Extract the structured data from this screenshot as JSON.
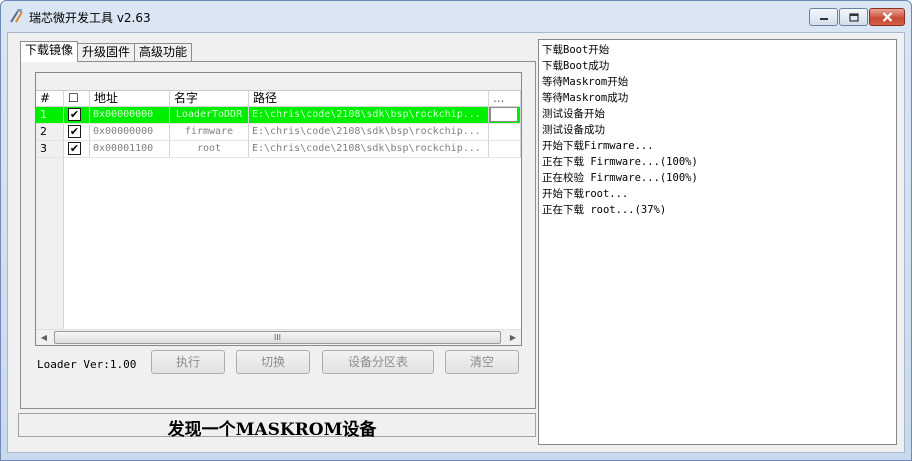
{
  "window": {
    "title": "瑞芯微开发工具 v2.63"
  },
  "tabs": [
    {
      "label": "下载镜像",
      "active": true
    },
    {
      "label": "升级固件",
      "active": false
    },
    {
      "label": "高级功能",
      "active": false
    }
  ],
  "grid": {
    "headers": [
      "#",
      "☐",
      "地址",
      "名字",
      "路径",
      "..."
    ],
    "rows": [
      {
        "num": "1",
        "checked": "✔",
        "address": "0x00000000",
        "name": "LoaderToDDR",
        "path": "E:\\chris\\code\\2108\\sdk\\bsp\\rockchip...",
        "selected": true
      },
      {
        "num": "2",
        "checked": "✔",
        "address": "0x00000000",
        "name": "firmware",
        "path": "E:\\chris\\code\\2108\\sdk\\bsp\\rockchip...",
        "selected": false
      },
      {
        "num": "3",
        "checked": "✔",
        "address": "0x00001100",
        "name": "root",
        "path": "E:\\chris\\code\\2108\\sdk\\bsp\\rockchip...",
        "selected": false
      }
    ],
    "scroll_thumb_grip": "III"
  },
  "loader_version": "Loader Ver:1.00",
  "buttons": {
    "execute": "执行",
    "switch": "切换",
    "partition_table": "设备分区表",
    "clear": "清空"
  },
  "status": "发现一个MASKROM设备",
  "log": [
    "下载Boot开始",
    "下载Boot成功",
    "等待Maskrom开始",
    "等待Maskrom成功",
    "测试设备开始",
    "测试设备成功",
    "开始下载Firmware...",
    "正在下载 Firmware...(100%)",
    "正在校验 Firmware...(100%)",
    "开始下载root...",
    "正在下载 root...(37%)"
  ],
  "colors": {
    "selected_row": "#00ee00",
    "close_button": "#c74a36"
  },
  "icons": {
    "app": "rockchip-tool-icon",
    "minimize": "minimize-icon",
    "maximize": "maximize-icon",
    "close": "close-icon"
  }
}
